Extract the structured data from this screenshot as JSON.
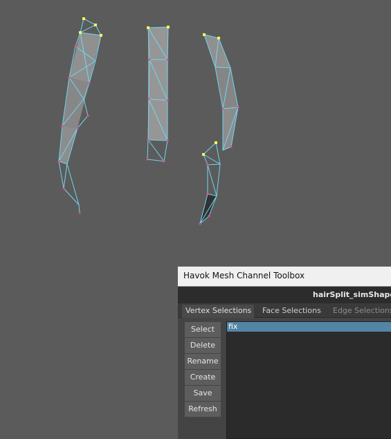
{
  "toolbox": {
    "title": "Havok Mesh Channel Toolbox",
    "shape_name": "hairSplit_simShape",
    "tabs": [
      {
        "label": "Vertex Selections",
        "active": true
      },
      {
        "label": "Face Selections",
        "active": false
      },
      {
        "label": "Edge Selections",
        "active": false
      }
    ],
    "buttons": {
      "select": "Select",
      "delete": "Delete",
      "rename": "Rename",
      "create": "Create",
      "save": "Save",
      "refresh": "Refresh"
    },
    "selection_list": [
      {
        "name": "fix",
        "selected": true
      }
    ]
  },
  "viewport": {
    "background_color": "#5b5b5b",
    "wire_color": "#6fd8f0",
    "face_color": "#9a9a9a",
    "vertex_color": "#e0508c",
    "selected_vertex_color": "#f4f45a",
    "meshes": [
      "hair-strand-left",
      "hair-strand-middle",
      "hair-strand-right-upper",
      "hair-strand-right-lower"
    ]
  }
}
